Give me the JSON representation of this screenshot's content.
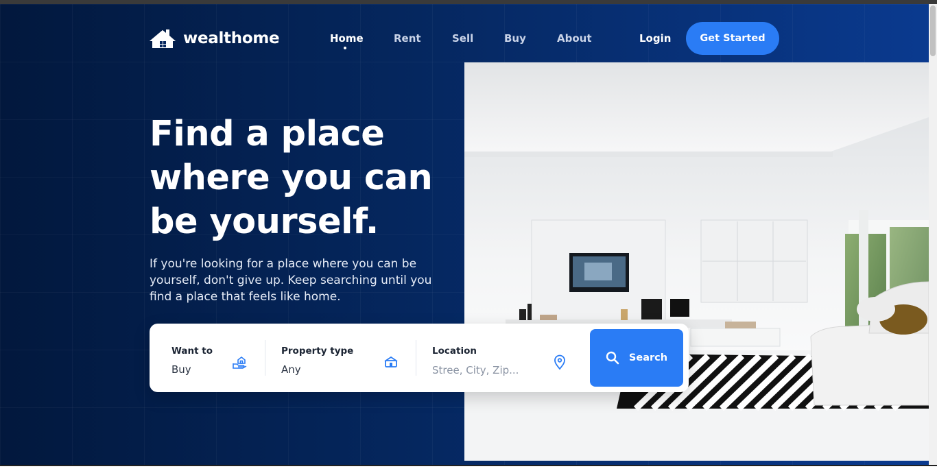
{
  "brand": {
    "name": "wealthome",
    "accent": "#2a7cf5",
    "hero_bg": "#05275f"
  },
  "nav": {
    "items": [
      {
        "label": "Home",
        "active": true
      },
      {
        "label": "Rent",
        "active": false
      },
      {
        "label": "Sell",
        "active": false
      },
      {
        "label": "Buy",
        "active": false
      },
      {
        "label": "About",
        "active": false
      }
    ],
    "login": "Login",
    "cta": "Get Started"
  },
  "hero": {
    "headline": "Find a place where you can be yourself.",
    "subtext": "If you're looking for a place where you can be yourself, don't give up. Keep searching until you find a place that feels like home."
  },
  "search": {
    "want_to": {
      "label": "Want to",
      "value": "Buy",
      "icon": "hand-house-icon"
    },
    "property_type": {
      "label": "Property type",
      "value": "Any",
      "icon": "house-icon"
    },
    "location": {
      "label": "Location",
      "placeholder": "Stree, City, Zip...",
      "icon": "map-pin-icon"
    },
    "button": {
      "label": "Search",
      "icon": "search-icon"
    }
  }
}
